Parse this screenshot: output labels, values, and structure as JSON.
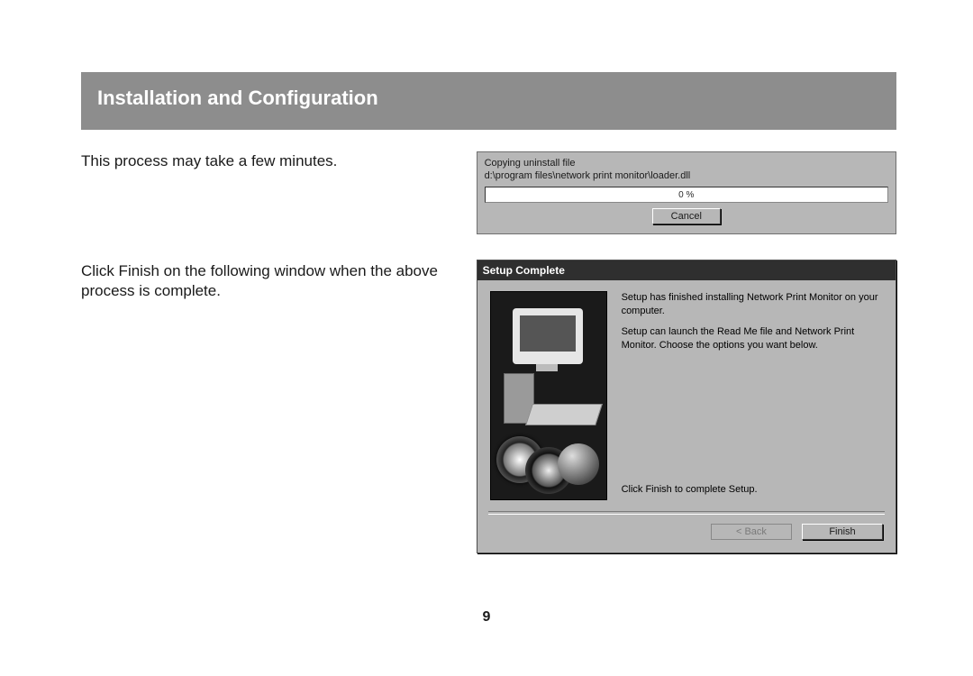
{
  "banner": {
    "title": "Installation and Configuration"
  },
  "instructions": {
    "line1": "This process may take a few minutes.",
    "line2": "Click Finish on the following window when the above process is complete."
  },
  "progress_dialog": {
    "copying_label": "Copying uninstall file",
    "path": "d:\\program files\\network print monitor\\loader.dll",
    "percent_text": "0 %",
    "cancel_label": "Cancel"
  },
  "setup_dialog": {
    "title": "Setup Complete",
    "msg1": "Setup has finished installing Network Print Monitor on your computer.",
    "msg2": "Setup can launch the Read Me file and Network Print Monitor. Choose the options you want below.",
    "finish_hint": "Click Finish to complete Setup.",
    "back_label": "< Back",
    "finish_label": "Finish"
  },
  "page_number": "9"
}
